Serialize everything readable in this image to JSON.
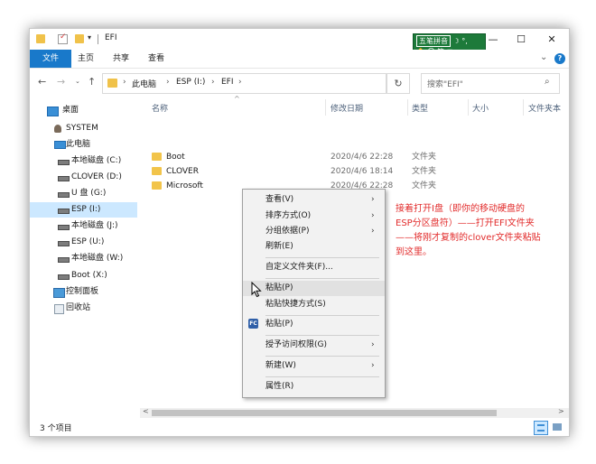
{
  "window": {
    "title": "EFI"
  },
  "titlebar": {
    "dropdown": "▾"
  },
  "ime": {
    "label": "五笔拼音",
    "row1_extra": "☽ °,",
    "row2": "✋ 〇 简 ⊞"
  },
  "window_buttons": {
    "minimize": "—",
    "maximize": "☐",
    "close": "✕"
  },
  "ribbon": {
    "tabs": [
      "文件",
      "主页",
      "共享",
      "查看"
    ],
    "expand": "⌄",
    "help": "?"
  },
  "nav_controls": {
    "back": "←",
    "forward": "→",
    "recent": "⌄",
    "up": "↑"
  },
  "address": {
    "separator": "›",
    "crumbs": [
      "此电脑",
      "ESP (I:)",
      "EFI"
    ],
    "dropdown": "⌄",
    "refresh": "↻"
  },
  "search": {
    "placeholder": "搜索\"EFI\"",
    "icon": "⌕"
  },
  "navpane": {
    "items": [
      {
        "label": "桌面",
        "icon": "desktop-icon"
      },
      {
        "label": "SYSTEM",
        "icon": "user-folder-icon"
      },
      {
        "label": "此电脑",
        "icon": "pc-icon"
      },
      {
        "label": "本地磁盘 (C:)",
        "icon": "drive-icon"
      },
      {
        "label": "CLOVER (D:)",
        "icon": "drive-icon"
      },
      {
        "label": "U 盘 (G:)",
        "icon": "drive-icon"
      },
      {
        "label": "ESP (I:)",
        "icon": "drive-icon",
        "selected": true
      },
      {
        "label": "本地磁盘 (J:)",
        "icon": "drive-icon"
      },
      {
        "label": "ESP (U:)",
        "icon": "drive-icon"
      },
      {
        "label": "本地磁盘 (W:)",
        "icon": "drive-icon"
      },
      {
        "label": "Boot (X:)",
        "icon": "drive-icon"
      },
      {
        "label": "控制面板",
        "icon": "control-panel-icon"
      },
      {
        "label": "回收站",
        "icon": "recycle-bin-icon"
      }
    ]
  },
  "columns": [
    "名称",
    "修改日期",
    "类型",
    "大小",
    "文件夹本"
  ],
  "sort_indicator": "^",
  "files": [
    {
      "name": "Boot",
      "date": "2020/4/6 22:28",
      "type": "文件夹"
    },
    {
      "name": "CLOVER",
      "date": "2020/4/6 18:14",
      "type": "文件夹"
    },
    {
      "name": "Microsoft",
      "date": "2020/4/6 22:28",
      "type": "文件夹"
    }
  ],
  "scroll": {
    "left": "<",
    "right": ">"
  },
  "status": {
    "count": "3 个项目"
  },
  "context_menu": {
    "items": [
      {
        "label": "查看(V)",
        "submenu": true
      },
      {
        "label": "排序方式(O)",
        "submenu": true
      },
      {
        "label": "分组依据(P)",
        "submenu": true
      },
      {
        "label": "刷新(E)"
      },
      {
        "label": "自定义文件夹(F)..."
      },
      {
        "label": "粘贴(P)",
        "highlighted": true
      },
      {
        "label": "粘贴快捷方式(S)"
      },
      {
        "label": "粘贴(P)",
        "icon": "FC"
      },
      {
        "label": "授予访问权限(G)",
        "submenu": true
      },
      {
        "label": "新建(W)",
        "submenu": true
      },
      {
        "label": "属性(R)"
      }
    ],
    "chevron": "›"
  },
  "annotation": {
    "lines": [
      "接着打开I盘（即你的移动硬盘的",
      "ESP分区盘符）——打开EFI文件夹",
      "——将刚才复制的clover文件夹粘贴",
      "到这里。"
    ],
    "color": "#e22c2c"
  }
}
